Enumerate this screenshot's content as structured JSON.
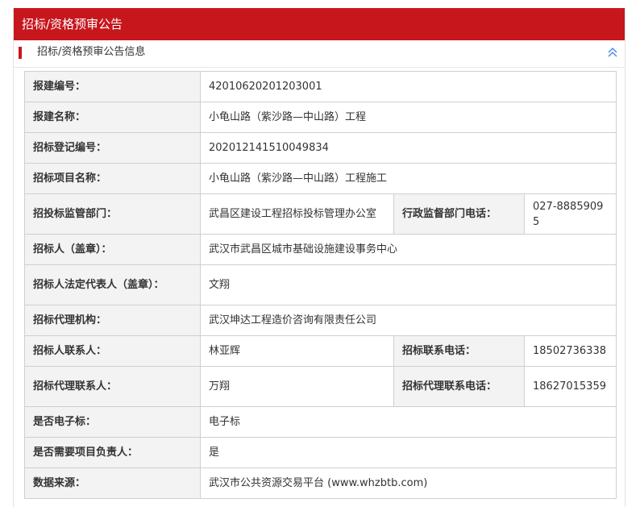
{
  "header": {
    "title": "招标/资格预审公告"
  },
  "section": {
    "title": "招标/资格预审公告信息",
    "collapse_icon": "double-chevron-up-icon",
    "accent_color": "#c8161d"
  },
  "fields": {
    "bjbh": {
      "label": "报建编号：",
      "value": "42010620201203001"
    },
    "bjmc": {
      "label": "报建名称：",
      "value": "小龟山路（紫沙路—中山路）工程"
    },
    "zbdjbh": {
      "label": "招标登记编号：",
      "value": "202012141510049834"
    },
    "zbxmmc": {
      "label": "招标项目名称：",
      "value": "小龟山路（紫沙路—中山路）工程施工"
    },
    "jgbm": {
      "label": "招投标监管部门：",
      "value": "武昌区建设工程招标投标管理办公室"
    },
    "xzjgdh": {
      "label": "行政监督部门电话：",
      "value": "027-88859095"
    },
    "zbr": {
      "label": "招标人（盖章）：",
      "value": "武汉市武昌区城市基础设施建设事务中心"
    },
    "fddbr": {
      "label": "招标人法定代表人（盖章）：",
      "value": "文翔"
    },
    "dljg": {
      "label": "招标代理机构：",
      "value": "武汉坤达工程造价咨询有限责任公司"
    },
    "zblxr": {
      "label": "招标人联系人：",
      "value": "林亚辉"
    },
    "zblxdh": {
      "label": "招标联系电话：",
      "value": "18502736338"
    },
    "dllxr": {
      "label": "招标代理联系人：",
      "value": "万翔"
    },
    "dllxdh": {
      "label": "招标代理联系电话：",
      "value": "18627015359"
    },
    "dzb": {
      "label": "是否电子标：",
      "value": "电子标"
    },
    "xmfzr": {
      "label": "是否需要项目负责人：",
      "value": "是"
    },
    "sjly": {
      "label": "数据来源：",
      "value": "武汉市公共资源交易平台 (www.whzbtb.com)"
    }
  }
}
